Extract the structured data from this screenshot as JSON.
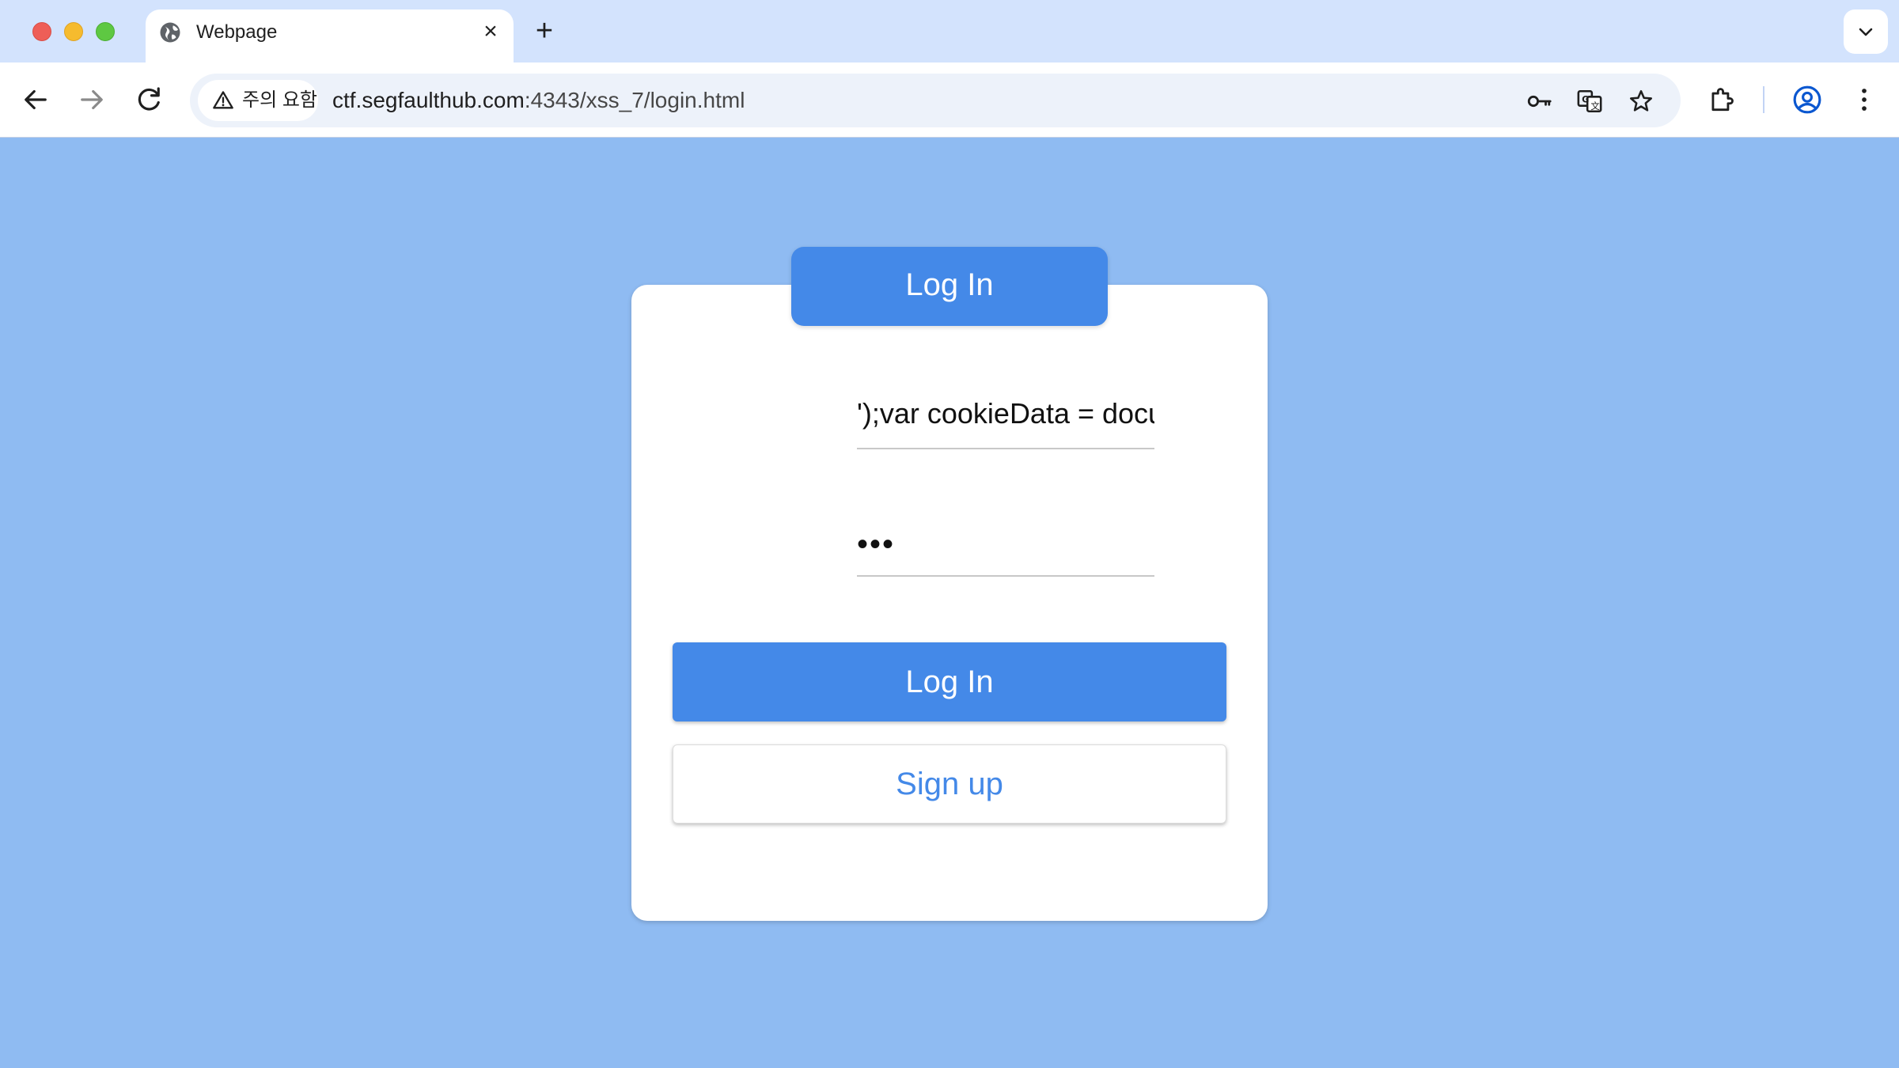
{
  "browser": {
    "tab": {
      "title": "Webpage",
      "close_glyph": "×",
      "icon": "globe-icon"
    },
    "new_tab_glyph": "+",
    "security_chip": {
      "label": "주의 요함",
      "icon": "warning-icon"
    },
    "url": {
      "host": "ctf.segfaulthub.com",
      "rest": ":4343/xss_7/login.html"
    },
    "toolbar_icons": [
      "back-icon",
      "forward-icon",
      "reload-icon",
      "key-icon",
      "translate-icon",
      "star-icon",
      "extensions-icon",
      "profile-icon",
      "menu-icon"
    ]
  },
  "login": {
    "header": "Log In",
    "username_value": "');var cookieData = docu",
    "password_value": "•••",
    "login_button": "Log In",
    "signup_button": "Sign up"
  },
  "colors": {
    "page_bg": "#8fbbf2",
    "accent": "#4489e8",
    "tabstrip": "#d3e3fd"
  }
}
